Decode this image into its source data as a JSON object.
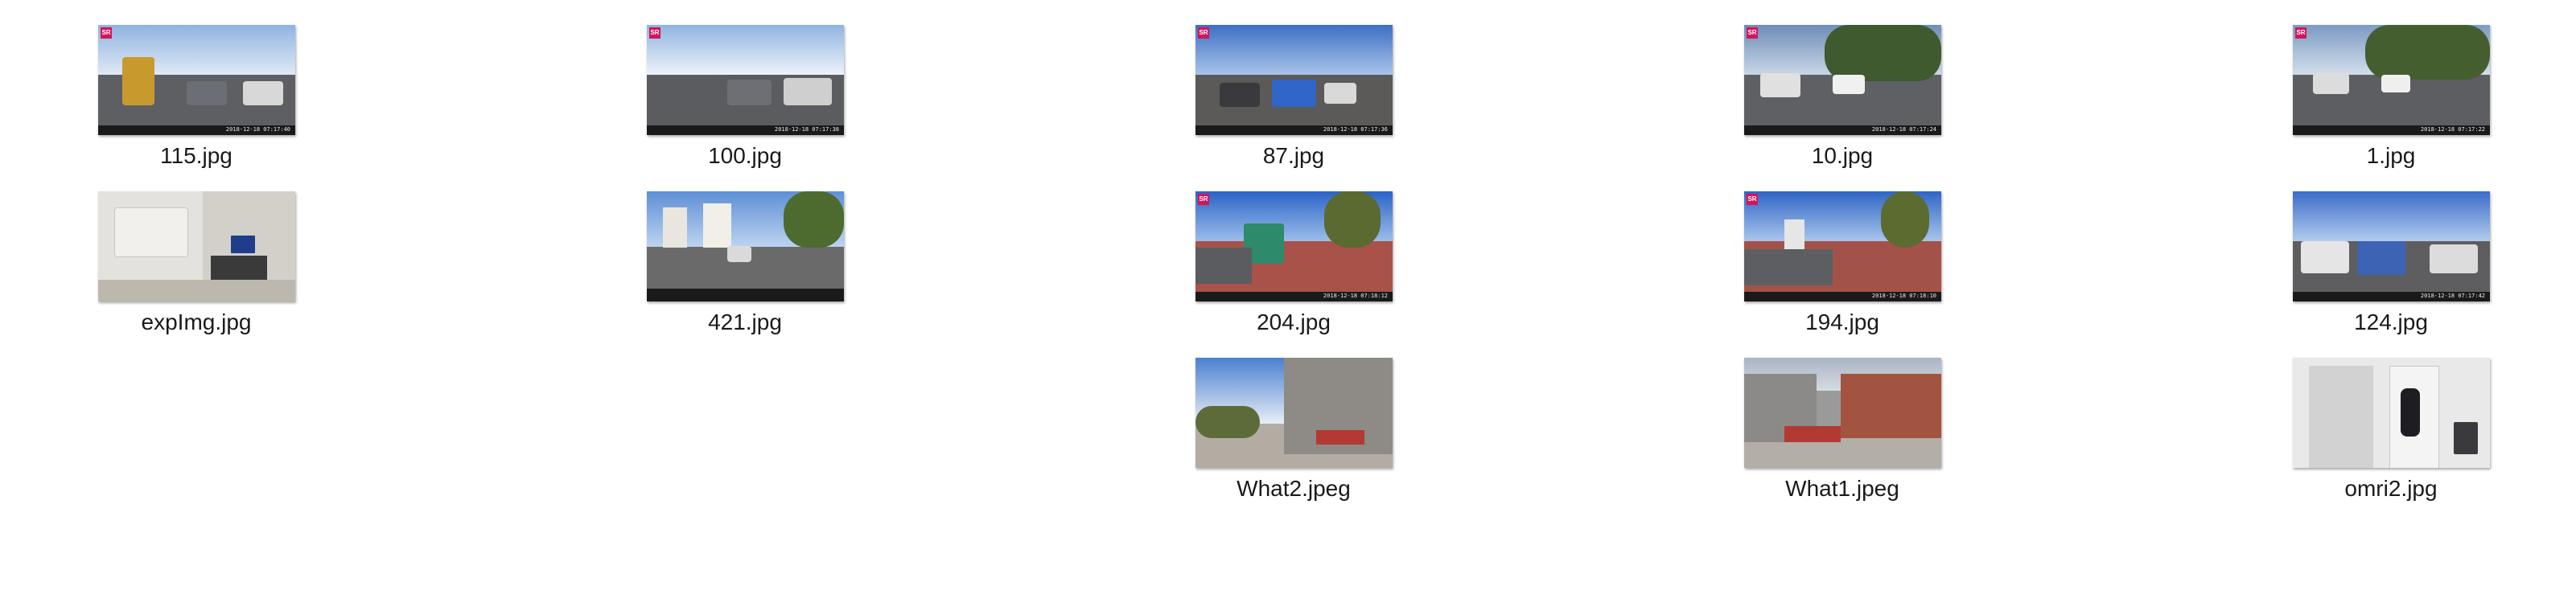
{
  "files": [
    {
      "name": "115.jpg",
      "badge": "SR",
      "stamp": "2018-12-18 07:17:40",
      "icon": "image-thumbnail-icon"
    },
    {
      "name": "100.jpg",
      "badge": "SR",
      "stamp": "2018-12-18 07:17:38",
      "icon": "image-thumbnail-icon"
    },
    {
      "name": "87.jpg",
      "badge": "SR",
      "stamp": "2018-12-18 07:17:36",
      "icon": "image-thumbnail-icon"
    },
    {
      "name": "10.jpg",
      "badge": "SR",
      "stamp": "2018-12-18 07:17:24",
      "icon": "image-thumbnail-icon"
    },
    {
      "name": "1.jpg",
      "badge": "SR",
      "stamp": "2018-12-18 07:17:22",
      "icon": "image-thumbnail-icon"
    },
    {
      "name": "expImg.jpg",
      "icon": "image-thumbnail-icon"
    },
    {
      "name": "421.jpg",
      "icon": "image-thumbnail-icon"
    },
    {
      "name": "204.jpg",
      "badge": "SR",
      "stamp": "2018-12-18 07:18:12",
      "icon": "image-thumbnail-icon"
    },
    {
      "name": "194.jpg",
      "badge": "SR",
      "stamp": "2018-12-18 07:18:10",
      "icon": "image-thumbnail-icon"
    },
    {
      "name": "124.jpg",
      "stamp": "2018-12-18 07:17:42",
      "icon": "image-thumbnail-icon"
    },
    {
      "name": "What2.jpeg",
      "icon": "image-thumbnail-icon"
    },
    {
      "name": "What1.jpeg",
      "icon": "image-thumbnail-icon"
    },
    {
      "name": "omri2.jpg",
      "icon": "image-thumbnail-icon"
    }
  ]
}
